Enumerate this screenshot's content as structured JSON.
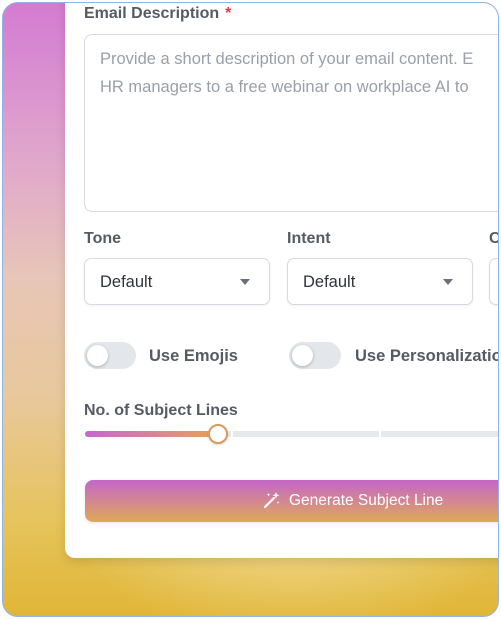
{
  "form": {
    "email_description": {
      "label": "Email Description",
      "required_mark": "*",
      "placeholder_line1": "Provide a short description of your email content. E",
      "placeholder_line2": "HR managers to a free webinar on workplace AI to"
    },
    "tone": {
      "label": "Tone",
      "value": "Default"
    },
    "intent": {
      "label": "Intent",
      "value": "Default"
    },
    "third_field": {
      "label": "C"
    },
    "use_emojis": {
      "label": "Use Emojis",
      "on": false
    },
    "use_personalization": {
      "label": "Use Personalization",
      "on": false
    },
    "subject_lines": {
      "label": "No. of Subject Lines",
      "fill_fraction": 0.3
    },
    "generate_button": {
      "label": "Generate Subject Line",
      "icon": "magic-wand-icon"
    }
  }
}
